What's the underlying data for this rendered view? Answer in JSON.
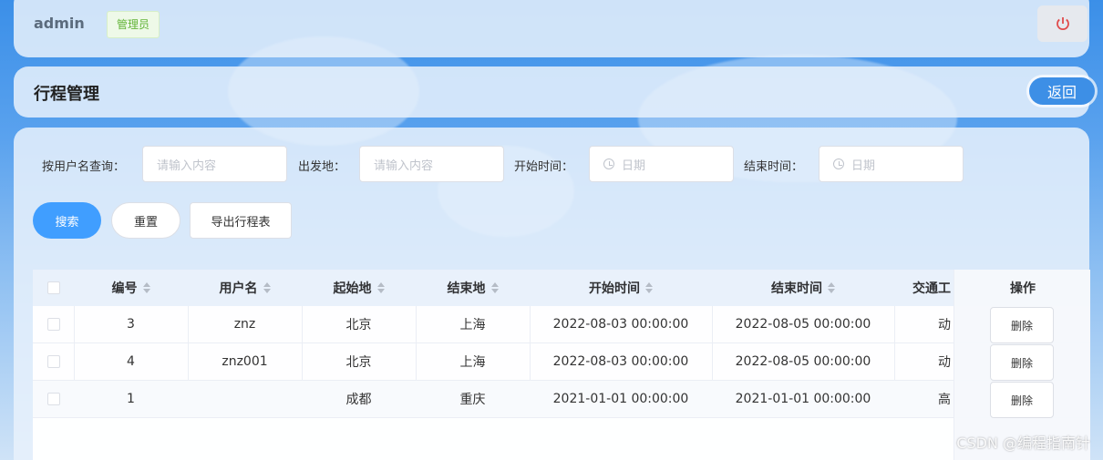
{
  "header": {
    "user": "admin",
    "role": "管理员"
  },
  "page": {
    "title": "行程管理",
    "back_label": "返回"
  },
  "filters": {
    "username_label": "按用户名查询：",
    "username_placeholder": "请输入内容",
    "origin_label": "出发地：",
    "origin_placeholder": "请输入内容",
    "start_label": "开始时间：",
    "start_placeholder": "日期",
    "end_label": "结束时间：",
    "end_placeholder": "日期"
  },
  "actions": {
    "search": "搜索",
    "reset": "重置",
    "export": "导出行程表"
  },
  "table": {
    "columns": [
      "编号",
      "用户名",
      "起始地",
      "结束地",
      "开始时间",
      "结束时间",
      "交通工",
      "操作"
    ],
    "rows": [
      {
        "id": "3",
        "user": "znz",
        "from": "北京",
        "to": "上海",
        "start": "2022-08-03 00:00:00",
        "end": "2022-08-05 00:00:00",
        "transport": "动",
        "action": "删除"
      },
      {
        "id": "4",
        "user": "znz001",
        "from": "北京",
        "to": "上海",
        "start": "2022-08-03 00:00:00",
        "end": "2022-08-05 00:00:00",
        "transport": "动",
        "action": "删除"
      },
      {
        "id": "1",
        "user": "",
        "from": "成都",
        "to": "重庆",
        "start": "2021-01-01 00:00:00",
        "end": "2021-01-01 00:00:00",
        "transport": "高",
        "action": "删除"
      }
    ]
  },
  "watermark": "CSDN @编程指南针",
  "colors": {
    "primary": "#409eff",
    "power": "#e04b4b",
    "role": "#62b437"
  }
}
